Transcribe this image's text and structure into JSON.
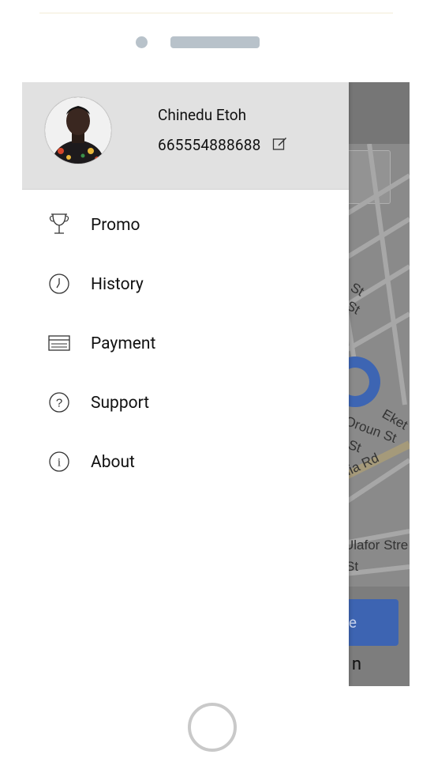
{
  "profile": {
    "name": "Chinedu Etoh",
    "phone": "665554888688"
  },
  "menu": [
    {
      "label": "Promo",
      "icon": "trophy-icon"
    },
    {
      "label": "History",
      "icon": "clock-icon"
    },
    {
      "label": "Payment",
      "icon": "credit-card-icon"
    },
    {
      "label": "Support",
      "icon": "help-circle-icon"
    },
    {
      "label": "About",
      "icon": "info-circle-icon"
    }
  ],
  "map": {
    "street_labels": [
      "St",
      "St",
      "St",
      "Eket",
      "Oroun St",
      "St",
      "Ufia Rd",
      "Ulafor Stre",
      "St"
    ],
    "action_button_partial": "e",
    "bottom_text_partial": "n"
  },
  "colors": {
    "drawer_header_bg": "#e1e1e1",
    "accent_blue": "#3d64b2",
    "overlay_gray": "#8a8a8a"
  }
}
